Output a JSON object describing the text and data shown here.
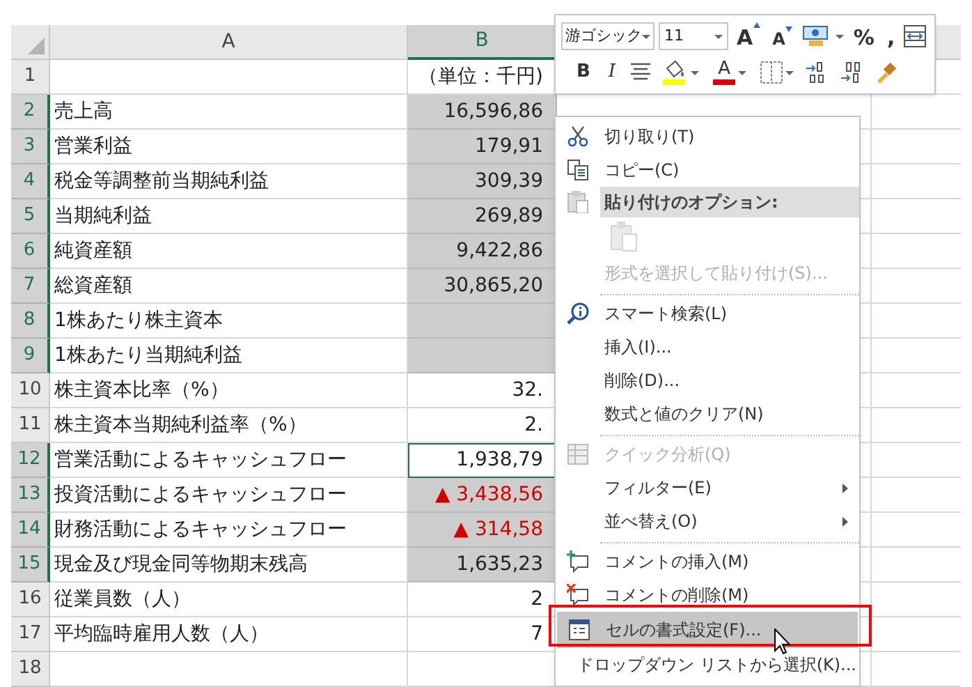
{
  "sheet": {
    "columns": [
      {
        "label": "A",
        "selected": false
      },
      {
        "label": "B",
        "selected": true
      }
    ],
    "rows": [
      {
        "number": "1",
        "value": "（単位：千円)",
        "selected": false,
        "active": false,
        "negative": false
      },
      {
        "number": "2",
        "label": "売上高",
        "value": "16,596,86",
        "selected": true,
        "active": false,
        "negative": false
      },
      {
        "number": "3",
        "label": "営業利益",
        "value": "179,91",
        "selected": true,
        "active": false,
        "negative": false
      },
      {
        "number": "4",
        "label": "税金等調整前当期純利益",
        "value": "309,39",
        "selected": true,
        "active": false,
        "negative": false
      },
      {
        "number": "5",
        "label": "当期純利益",
        "value": "269,89",
        "selected": true,
        "active": false,
        "negative": false
      },
      {
        "number": "6",
        "label": "純資産額",
        "value": "9,422,86",
        "selected": true,
        "active": false,
        "negative": false
      },
      {
        "number": "7",
        "label": "総資産額",
        "value": "30,865,20",
        "selected": true,
        "active": false,
        "negative": false
      },
      {
        "number": "8",
        "label": "1株あたり株主資本",
        "selected": true,
        "active": false,
        "negative": false
      },
      {
        "number": "9",
        "label": "1株あたり当期純利益",
        "selected": true,
        "active": false,
        "negative": false
      },
      {
        "number": "10",
        "label": "株主資本比率（%）",
        "value": "32.",
        "selected": false,
        "active": false,
        "negative": false
      },
      {
        "number": "11",
        "label": "株主資本当期純利益率（%）",
        "value": "2.",
        "selected": false,
        "active": false,
        "negative": false
      },
      {
        "number": "12",
        "label": "営業活動によるキャッシュフロー",
        "value": "1,938,79",
        "selected": true,
        "active": true,
        "negative": false
      },
      {
        "number": "13",
        "label": "投資活動によるキャッシュフロー",
        "value": "▲ 3,438,56",
        "selected": true,
        "active": false,
        "negative": true
      },
      {
        "number": "14",
        "label": "財務活動によるキャッシュフロー",
        "value": "▲ 314,58",
        "selected": true,
        "active": false,
        "negative": true
      },
      {
        "number": "15",
        "label": "現金及び現金同等物期末残高",
        "value": "1,635,23",
        "selected": true,
        "active": false,
        "negative": false
      },
      {
        "number": "16",
        "label": "従業員数（人）",
        "value": "2",
        "selected": false,
        "active": false,
        "negative": false
      },
      {
        "number": "17",
        "label": "平均臨時雇用人数（人）",
        "value": "7",
        "selected": false,
        "active": false,
        "negative": false
      },
      {
        "number": "18",
        "selected": false,
        "active": false
      }
    ]
  },
  "mini_toolbar": {
    "font": "游ゴシック",
    "size": "11",
    "row_1": [
      {
        "kind": "grow",
        "label": "A"
      },
      {
        "kind": "shrink",
        "label": "A"
      },
      {
        "kind": "accounting"
      },
      {
        "kind": "percent",
        "label": "%"
      },
      {
        "kind": "comma",
        "label": ","
      },
      {
        "kind": "wrap"
      }
    ],
    "row_2": [
      {
        "kind": "bold",
        "label": "B"
      },
      {
        "kind": "italic",
        "label": "I"
      },
      {
        "kind": "align"
      },
      {
        "kind": "fill"
      },
      {
        "kind": "fontcolor",
        "label": "A"
      },
      {
        "kind": "borders"
      },
      {
        "kind": "incdec"
      },
      {
        "kind": "decdec"
      },
      {
        "kind": "painter"
      }
    ]
  },
  "context_menu": {
    "items": [
      {
        "kind": "cut",
        "label": "切り取り(T)",
        "disabled": false,
        "selected": false,
        "submenu": false
      },
      {
        "kind": "copy",
        "label": "コピー(C)",
        "disabled": false,
        "selected": false,
        "submenu": false
      },
      {
        "kind": "header",
        "label": "貼り付けのオプション:"
      },
      {
        "kind": "paste_options",
        "disabled": true,
        "selected": false
      },
      {
        "kind": "plain",
        "label": "形式を選択して貼り付け(S)...",
        "disabled": true,
        "selected": false,
        "submenu": false
      },
      {
        "kind": "separator"
      },
      {
        "kind": "search",
        "label": "スマート検索(L)",
        "disabled": false,
        "selected": false,
        "submenu": false
      },
      {
        "kind": "plain",
        "label": "挿入(I)...",
        "disabled": false,
        "selected": false,
        "submenu": false
      },
      {
        "kind": "plain",
        "label": "削除(D)...",
        "disabled": false,
        "selected": false,
        "submenu": false
      },
      {
        "kind": "plain",
        "label": "数式と値のクリア(N)",
        "disabled": false,
        "selected": false,
        "submenu": false
      },
      {
        "kind": "separator"
      },
      {
        "kind": "quick",
        "label": "クイック分析(Q)",
        "disabled": true,
        "selected": false,
        "submenu": false
      },
      {
        "kind": "plain",
        "label": "フィルター(E)",
        "disabled": false,
        "selected": false,
        "submenu": true
      },
      {
        "kind": "plain",
        "label": "並べ替え(O)",
        "disabled": false,
        "selected": false,
        "submenu": true
      },
      {
        "kind": "separator"
      },
      {
        "kind": "comment_add",
        "label": "コメントの挿入(M)",
        "disabled": false,
        "selected": false,
        "submenu": false
      },
      {
        "kind": "comment_delete",
        "label": "コメントの削除(M)",
        "disabled": false,
        "selected": false,
        "submenu": false
      },
      {
        "kind": "format",
        "label": "セルの書式設定(F)...",
        "disabled": false,
        "selected": true,
        "submenu": false
      },
      {
        "kind": "plain",
        "label": "ドロップダウン リストから選択(K)...",
        "disabled": false,
        "selected": false,
        "submenu": false
      }
    ]
  }
}
